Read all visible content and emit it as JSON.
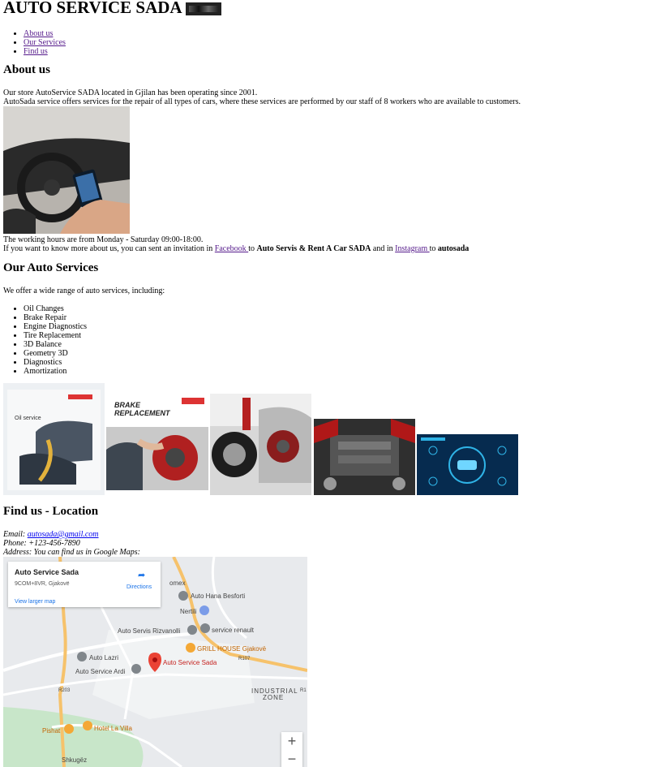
{
  "header": {
    "title": "AUTO SERVICE SADA"
  },
  "nav": {
    "items": [
      "About us",
      "Our Services",
      "Find us"
    ]
  },
  "about": {
    "heading": "About us",
    "line1": "Our store AutoService SADA located in Gjilan has been operating since 2001.",
    "line2": "AutoSada service offers services for the repair of all types of cars, where these services are performed by our staff of 8 workers who are available to customers.",
    "hours": "The working hours are from Monday - Saturday 09:00-18:00.",
    "invite_pre": "If you want to know more about us, you can sent an invitation in ",
    "facebook_link": "Facebook ",
    "to1": " to ",
    "facebook_name": "Auto Servis & Rent A Car SADA",
    "and_in": " and in ",
    "instagram_link": "Instagram ",
    "to2": " to ",
    "instagram_name": "autosada"
  },
  "services": {
    "heading": "Our Auto Services",
    "intro": "We offer a wide range of auto services, including:",
    "items": [
      "Oil Changes",
      "Brake Repair",
      "Engine Diagnostics",
      "Tire Replacement",
      "3D Balance",
      "Geometry 3D",
      "Diagnostics",
      "Amortization"
    ],
    "image_captions": [
      "Oil service",
      "BRAKE REPLACEMENT"
    ]
  },
  "findus": {
    "heading": "Find us - Location",
    "email_label": "Email: ",
    "email": "autosada@gmail.com",
    "phone": "Phone: +123-456-7890",
    "address": "Address: You can find us in Google Maps:"
  },
  "map": {
    "place_name": "Auto Service Sada",
    "place_address": "9COM+8VR, Gjakovë",
    "directions": "Directions",
    "larger_map": "View larger map",
    "labels": [
      "Auto Hana Besforti",
      "Nertili",
      "Auto Servis Rizvanolli",
      "service renault",
      "GRILL HOUSE Gjakovë",
      "Auto Lazri",
      "Auto Service Ardi",
      "Auto Service Sada",
      "INDUSTRIAL",
      "ZONE",
      "Pishat",
      "Hotel La Villa",
      "Shkugëz",
      "R107",
      "R203",
      "R1",
      "omex"
    ],
    "zoom_in": "+",
    "zoom_out": "−"
  }
}
